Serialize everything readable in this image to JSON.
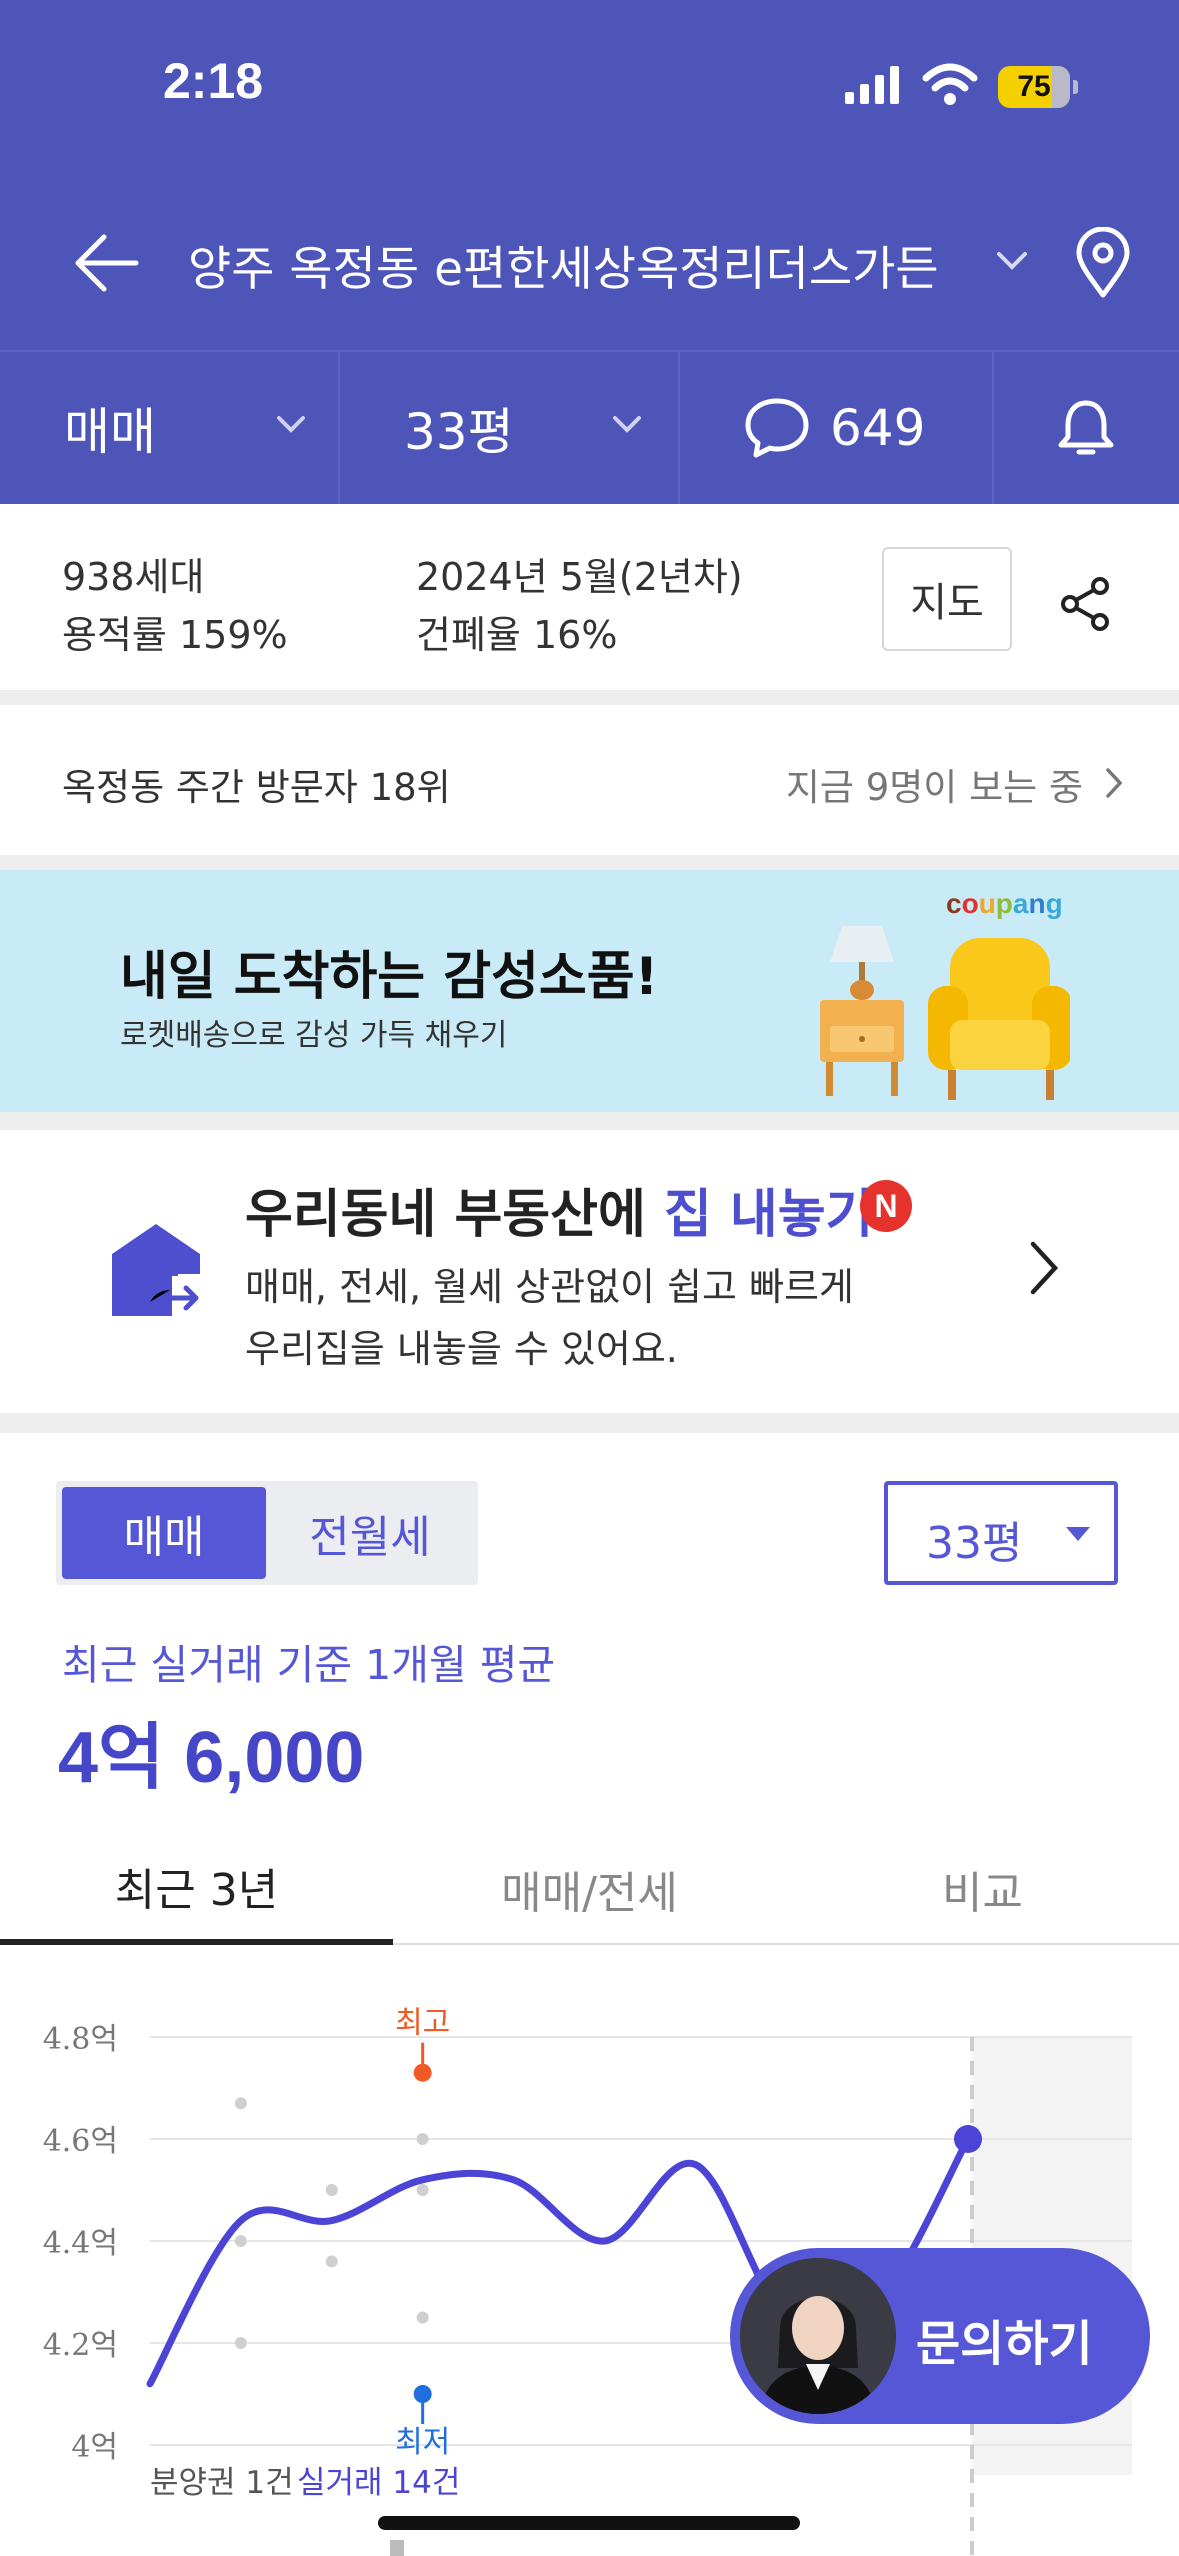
{
  "status_bar": {
    "time": "2:18",
    "battery": "75"
  },
  "header": {
    "title": "양주 옥정동 e편한세상옥정리더스가든"
  },
  "tabs": {
    "deal_type": "매매",
    "size": "33평",
    "comments_count": "649"
  },
  "info": {
    "households": "938세대",
    "floor_area_ratio": "용적률 159%",
    "built": "2024년 5월(2년차)",
    "coverage_ratio": "건폐율 16%",
    "map_button": "지도"
  },
  "visitors": {
    "rank": "옥정동 주간 방문자 18위",
    "watching": "지금 9명이 보는 중"
  },
  "ad": {
    "headline": "내일 도착하는 감성소품!",
    "sub": "로켓배송으로 감성 가득 채우기",
    "brand": "coupang"
  },
  "sell": {
    "title_prefix": "우리동네 부동산에 ",
    "title_accent": "집 내놓기",
    "badge": "N",
    "desc_line1": "매매, 전세, 월세 상관없이 쉽고 빠르게",
    "desc_line2": "우리집을 내놓을 수 있어요."
  },
  "price": {
    "seg_sale": "매매",
    "seg_rent": "전월세",
    "size_select": "33평",
    "avg_label": "최근 실거래 기준 1개월 평균",
    "avg_value": "4억 6,000"
  },
  "chart_tabs": [
    "최근 3년",
    "매매/전세",
    "비교"
  ],
  "chart_data": {
    "type": "line",
    "y_tick_labels": [
      "4.8억",
      "4.6억",
      "4.4억",
      "4.2억",
      "4억"
    ],
    "ylim": [
      4.0,
      4.8
    ],
    "series": [
      {
        "values": [
          4.12,
          4.44,
          4.44,
          4.52,
          4.52,
          4.4,
          4.55,
          4.25,
          4.28,
          4.6
        ]
      }
    ],
    "scatter": [
      {
        "x": 1,
        "y": 4.67
      },
      {
        "x": 1,
        "y": 4.4
      },
      {
        "x": 1,
        "y": 4.2
      },
      {
        "x": 2,
        "y": 4.5
      },
      {
        "x": 2,
        "y": 4.36
      },
      {
        "x": 3,
        "y": 4.6
      },
      {
        "x": 3,
        "y": 4.5
      },
      {
        "x": 3,
        "y": 4.25
      }
    ],
    "max_label": "최고",
    "max_value": 4.73,
    "min_label": "최저",
    "min_value": 4.1,
    "footer_presale": "분양권 1건",
    "footer_trades": "실거래 14건"
  },
  "cta": {
    "label": "문의하기"
  },
  "colors": {
    "brand": "#4e55b8",
    "accent": "#5657d6",
    "max": "#f05a24",
    "min": "#1f6fe0"
  }
}
